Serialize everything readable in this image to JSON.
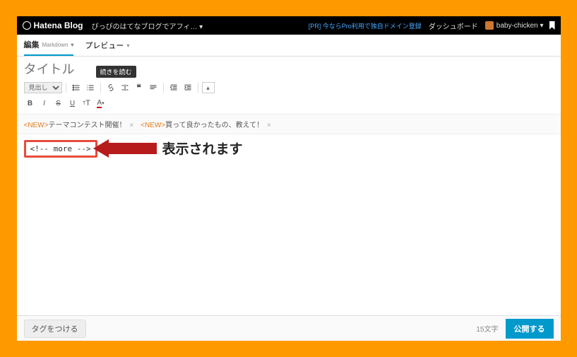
{
  "topbar": {
    "site_name": "Hatena Blog",
    "blog_title": "ぴっぴのはてなブログでアフィ… ▾",
    "promo": "[PR] 今ならPro利用で独自ドメイン登録",
    "dashboard": "ダッシュボード",
    "username": "baby-chicken ▾"
  },
  "tabs": {
    "edit": "編集",
    "edit_mode": "Markdown",
    "preview": "プレビュー"
  },
  "title": {
    "placeholder": "タイトル"
  },
  "toolbar": {
    "heading_select": "見出し",
    "tooltip": "続きを読む"
  },
  "topics": [
    {
      "new": "<NEW>",
      "text": "テーマコンテスト開催！"
    },
    {
      "new": "<NEW>",
      "text": "買って良かったもの、教えて！"
    }
  ],
  "editor": {
    "more_tag": "<!-- more -->",
    "annotation": "表示されます"
  },
  "footer": {
    "tag_button": "タグをつける",
    "char_count": "15文字",
    "publish": "公開する"
  }
}
